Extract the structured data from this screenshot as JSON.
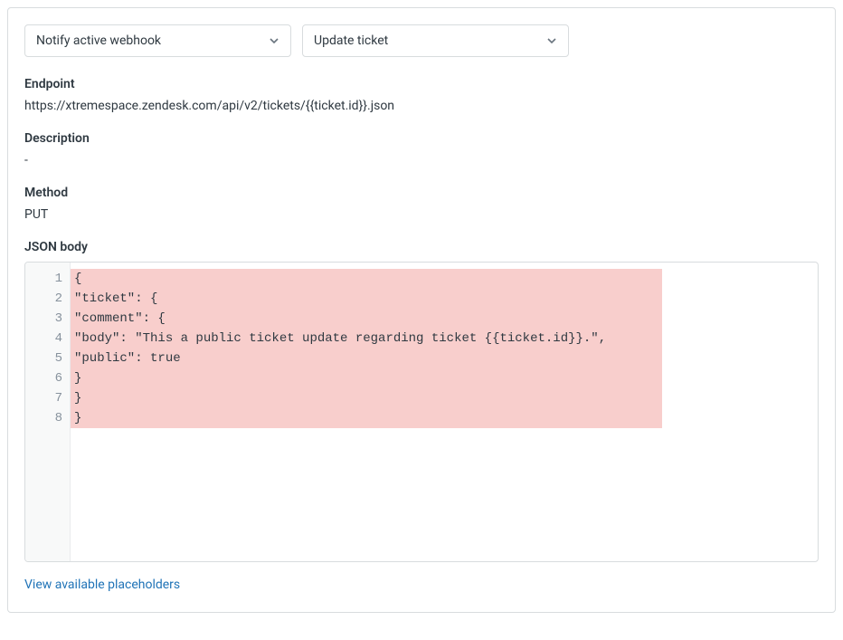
{
  "dropdowns": {
    "action": "Notify active webhook",
    "webhook": "Update ticket"
  },
  "fields": {
    "endpoint_label": "Endpoint",
    "endpoint_value": "https://xtremespace.zendesk.com/api/v2/tickets/{{ticket.id}}.json",
    "description_label": "Description",
    "description_value": "-",
    "method_label": "Method",
    "method_value": "PUT",
    "json_body_label": "JSON body"
  },
  "json_body_lines": [
    "{",
    "\"ticket\": {",
    "\"comment\": {",
    "\"body\": \"This a public ticket update regarding ticket {{ticket.id}}.\",",
    "\"public\": true",
    "}",
    "}",
    "}"
  ],
  "line_numbers": [
    "1",
    "2",
    "3",
    "4",
    "5",
    "6",
    "7",
    "8"
  ],
  "placeholder_link": "View available placeholders"
}
